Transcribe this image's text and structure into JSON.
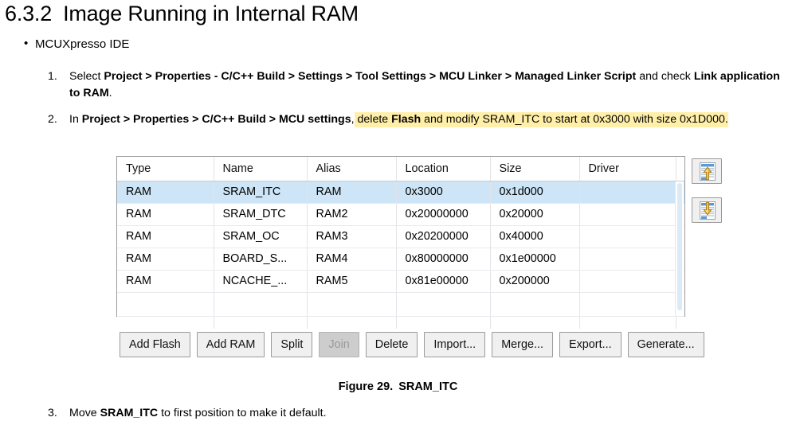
{
  "heading": {
    "number": "6.3.2",
    "title": "Image Running in Internal RAM"
  },
  "bullet": {
    "label": "MCUXpresso IDE"
  },
  "steps": [
    {
      "marker": "1.",
      "parts": [
        {
          "text": "Select ",
          "style": "normal"
        },
        {
          "text": "Project > Properties - C/C++ Build > Settings > Tool Settings > MCU Linker > Managed Linker Script",
          "style": "bold"
        },
        {
          "text": " and check ",
          "style": "normal"
        },
        {
          "text": "Link application to RAM",
          "style": "bold"
        },
        {
          "text": ".",
          "style": "normal"
        }
      ]
    },
    {
      "marker": "2.",
      "parts": [
        {
          "text": "In ",
          "style": "normal"
        },
        {
          "text": "Project > Properties > C/C++ Build > MCU settings",
          "style": "bold"
        },
        {
          "text": ",",
          "style": "normal"
        },
        {
          "text": " delete ",
          "style": "highlight"
        },
        {
          "text": "Flash",
          "style": "highlight-bold"
        },
        {
          "text": " and modify SRAM_ITC to start at 0x3000 with size 0x1D000.",
          "style": "highlight"
        }
      ]
    },
    {
      "marker": "3.",
      "parts": [
        {
          "text": "Move ",
          "style": "normal"
        },
        {
          "text": "SRAM_ITC",
          "style": "bold"
        },
        {
          "text": " to first position to make it default.",
          "style": "normal"
        }
      ]
    }
  ],
  "memory_table": {
    "columns": [
      "Type",
      "Name",
      "Alias",
      "Location",
      "Size",
      "Driver"
    ],
    "rows": [
      {
        "cells": [
          "RAM",
          "SRAM_ITC",
          "RAM",
          "0x3000",
          "0x1d000",
          ""
        ],
        "selected": true
      },
      {
        "cells": [
          "RAM",
          "SRAM_DTC",
          "RAM2",
          "0x20000000",
          "0x20000",
          ""
        ],
        "selected": false
      },
      {
        "cells": [
          "RAM",
          "SRAM_OC",
          "RAM3",
          "0x20200000",
          "0x40000",
          ""
        ],
        "selected": false
      },
      {
        "cells": [
          "RAM",
          "BOARD_S...",
          "RAM4",
          "0x80000000",
          "0x1e00000",
          ""
        ],
        "selected": false
      },
      {
        "cells": [
          "RAM",
          "NCACHE_...",
          "RAM5",
          "0x81e00000",
          "0x200000",
          ""
        ],
        "selected": false
      }
    ]
  },
  "side_buttons": [
    {
      "name": "move-up",
      "icon": "arrow-up-document-icon",
      "arrow": "up"
    },
    {
      "name": "move-down",
      "icon": "arrow-down-document-icon",
      "arrow": "down"
    }
  ],
  "action_buttons": [
    {
      "label": "Add Flash",
      "name": "add-flash-button",
      "disabled": false
    },
    {
      "label": "Add RAM",
      "name": "add-ram-button",
      "disabled": false
    },
    {
      "label": "Split",
      "name": "split-button",
      "disabled": false
    },
    {
      "label": "Join",
      "name": "join-button",
      "disabled": true
    },
    {
      "label": "Delete",
      "name": "delete-button",
      "disabled": false
    },
    {
      "label": "Import...",
      "name": "import-button",
      "disabled": false
    },
    {
      "label": "Merge...",
      "name": "merge-button",
      "disabled": false
    },
    {
      "label": "Export...",
      "name": "export-button",
      "disabled": false
    },
    {
      "label": "Generate...",
      "name": "generate-button",
      "disabled": false
    }
  ],
  "figure": {
    "label": "Figure 29.",
    "title": "SRAM_ITC"
  },
  "colors": {
    "selection_row": "#cde5f7",
    "highlight": "#ffefa8",
    "button_face": "#f0f0f0",
    "button_border": "#9a9a9a",
    "disabled_face": "#cdcdcd",
    "arrow_gold": "#e8b734"
  }
}
